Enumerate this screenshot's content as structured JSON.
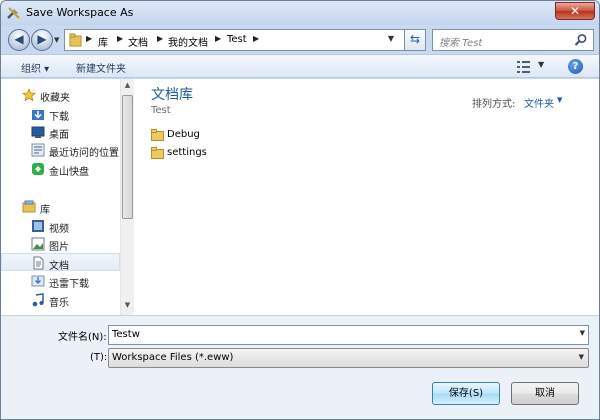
{
  "window": {
    "title": "Save Workspace As",
    "close_label": "✕"
  },
  "address": {
    "crumbs": [
      "库",
      "文档",
      "我的文档",
      "Test"
    ],
    "search_placeholder": "搜索 Test"
  },
  "toolbar": {
    "organize_label": "组织 ▾",
    "new_folder_label": "新建文件夹",
    "help_label": "?"
  },
  "sidebar": {
    "favorites_header": "收藏夹",
    "favorites": [
      "下载",
      "桌面",
      "最近访问的位置",
      "金山快盘"
    ],
    "libraries_header": "库",
    "libraries": [
      "视频",
      "图片",
      "文档",
      "迅雷下载",
      "音乐"
    ],
    "selected": "文档"
  },
  "file_pane": {
    "title": "文档库",
    "subtitle": "Test",
    "arrange_label": "排列方式:",
    "arrange_value": "文件夹",
    "items": [
      "Debug",
      "settings"
    ]
  },
  "form": {
    "filename_label": "文件名(N):",
    "filename_value": "Testw",
    "type_label": "(T):",
    "type_value": "Workspace Files (*.eww)",
    "save_label": "保存(S)",
    "cancel_label": "取消"
  },
  "colors": {
    "accent": "#1f5a9a",
    "window_frame": "#c9daf0"
  }
}
